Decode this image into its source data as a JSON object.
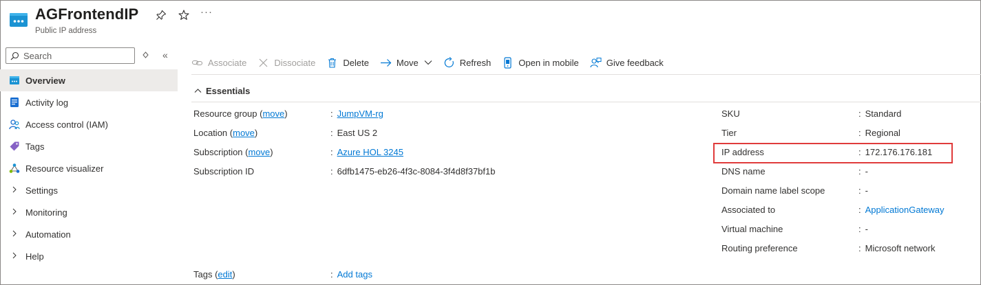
{
  "header": {
    "title": "AGFrontendIP",
    "subtitle": "Public IP address",
    "more": "···"
  },
  "sidebar": {
    "search_placeholder": "Search",
    "collapse": "«",
    "items": [
      {
        "label": "Overview",
        "icon": "overview-icon"
      },
      {
        "label": "Activity log",
        "icon": "activity-log-icon"
      },
      {
        "label": "Access control (IAM)",
        "icon": "iam-icon"
      },
      {
        "label": "Tags",
        "icon": "tag-icon"
      },
      {
        "label": "Resource visualizer",
        "icon": "resource-visualizer-icon"
      },
      {
        "label": "Settings",
        "icon": "chevron-right-icon"
      },
      {
        "label": "Monitoring",
        "icon": "chevron-right-icon"
      },
      {
        "label": "Automation",
        "icon": "chevron-right-icon"
      },
      {
        "label": "Help",
        "icon": "chevron-right-icon"
      }
    ]
  },
  "toolbar": {
    "associate": "Associate",
    "dissociate": "Dissociate",
    "delete": "Delete",
    "move": "Move",
    "refresh": "Refresh",
    "open_mobile": "Open in mobile",
    "feedback": "Give feedback"
  },
  "essentials": {
    "title": "Essentials",
    "left": {
      "resource_group_label": "Resource group",
      "resource_group_value": "JumpVM-rg",
      "location_label": "Location",
      "location_value": "East US 2",
      "subscription_label": "Subscription",
      "subscription_value": "Azure HOL 3245",
      "subscription_id_label": "Subscription ID",
      "subscription_id_value": "6dfb1475-eb26-4f3c-8084-3f4d8f37bf1b",
      "move_link": "move",
      "tags_label": "Tags",
      "tags_edit": "edit",
      "tags_value": "Add tags"
    },
    "right": [
      {
        "label": "SKU",
        "value": "Standard"
      },
      {
        "label": "Tier",
        "value": "Regional"
      },
      {
        "label": "IP address",
        "value": "172.176.176.181"
      },
      {
        "label": "DNS name",
        "value": "-"
      },
      {
        "label": "Domain name label scope",
        "value": "-"
      },
      {
        "label": "Associated to",
        "value": "ApplicationGateway"
      },
      {
        "label": "Virtual machine",
        "value": "-"
      },
      {
        "label": "Routing preference",
        "value": "Microsoft network"
      }
    ]
  },
  "colors": {
    "accent": "#0078d4",
    "highlight_border": "#e03a3a",
    "active_nav_bg": "#edebe9"
  }
}
